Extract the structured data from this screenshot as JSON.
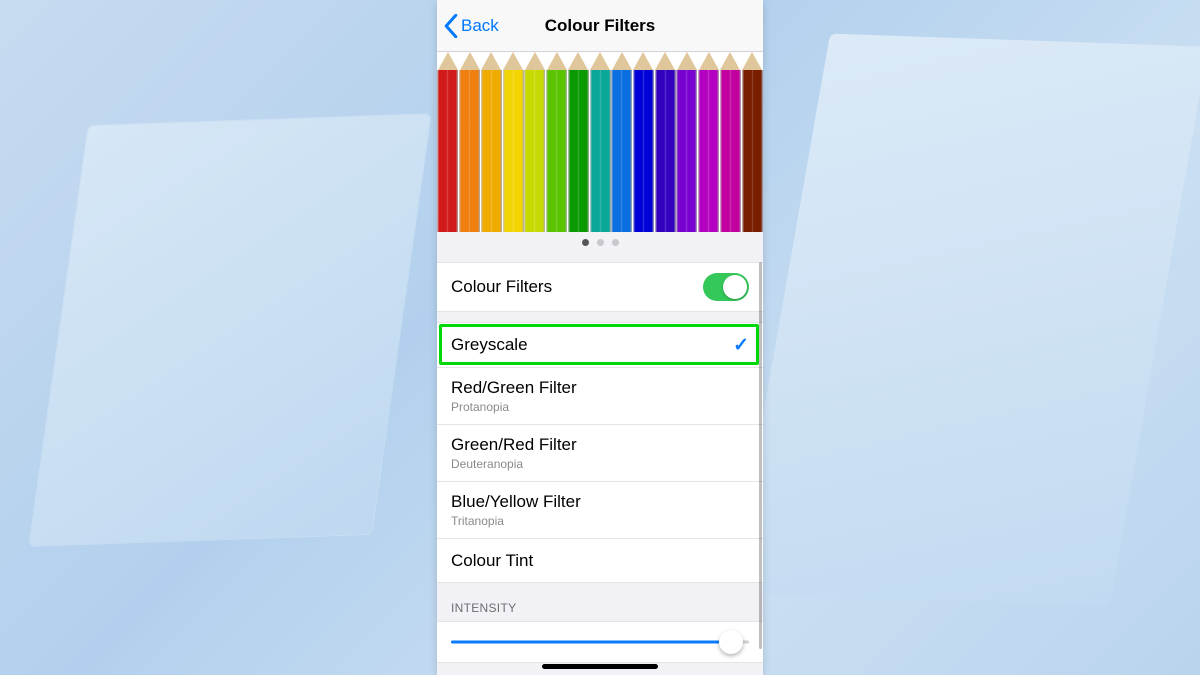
{
  "nav": {
    "back_label": "Back",
    "title": "Colour Filters"
  },
  "preview": {
    "pencil_colors": [
      "#d21a1a",
      "#ef7f0e",
      "#f0ab00",
      "#f2d400",
      "#c7da00",
      "#5bc400",
      "#0a9a00",
      "#0aa799",
      "#0a6fe0",
      "#0000d8",
      "#3400bf",
      "#7800d0",
      "#b400c0",
      "#c200a0",
      "#7a1e00"
    ],
    "page_dots": {
      "count": 3,
      "active": 0
    }
  },
  "toggle": {
    "label": "Colour Filters",
    "on": true
  },
  "filters": [
    {
      "label": "Greyscale",
      "sub": "",
      "selected": true,
      "highlighted": true
    },
    {
      "label": "Red/Green Filter",
      "sub": "Protanopia",
      "selected": false
    },
    {
      "label": "Green/Red Filter",
      "sub": "Deuteranopia",
      "selected": false
    },
    {
      "label": "Blue/Yellow Filter",
      "sub": "Tritanopia",
      "selected": false
    },
    {
      "label": "Colour Tint",
      "sub": "",
      "selected": false
    }
  ],
  "intensity": {
    "header": "INTENSITY",
    "value_pct": 94
  }
}
